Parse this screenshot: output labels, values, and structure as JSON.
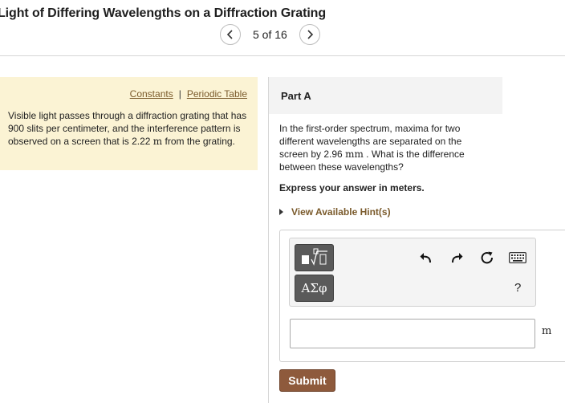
{
  "header": {
    "title": "Light of Differing Wavelengths on a Diffraction Grating",
    "pager": "5 of 16"
  },
  "info_panel": {
    "constants_link": "Constants",
    "separator": "|",
    "periodic_table_link": "Periodic Table",
    "problem_text_1": "Visible light passes through a diffraction grating that has 900 slits per centimeter, and the interference pattern is observed on a screen that is 2.22 ",
    "problem_unit": "m",
    "problem_text_2": " from the grating."
  },
  "part": {
    "label": "Part A",
    "question_1": "In the first-order spectrum, maxima for two different wavelengths are separated on the screen by 2.96 ",
    "question_unit": "mm",
    "question_2": " . What is the difference between these wavelengths?",
    "instruction": "Express your answer in meters.",
    "hint_link": "View Available Hint(s)"
  },
  "toolbar": {
    "greek_button": "ΑΣφ",
    "help_label": "?",
    "icons": [
      "templates-icon",
      "greek-letters-icon",
      "undo-icon",
      "redo-icon",
      "reset-icon",
      "keyboard-icon",
      "help-icon"
    ]
  },
  "answer": {
    "value": "",
    "unit": "m"
  },
  "submit_label": "Submit",
  "colors": {
    "info_panel_bg": "#fbf3d4",
    "link": "#7a5a2b",
    "submit_bg": "#8e5a3c",
    "tool_button_bg": "#5a5a5a",
    "part_header_bg": "#f3f3f3"
  }
}
